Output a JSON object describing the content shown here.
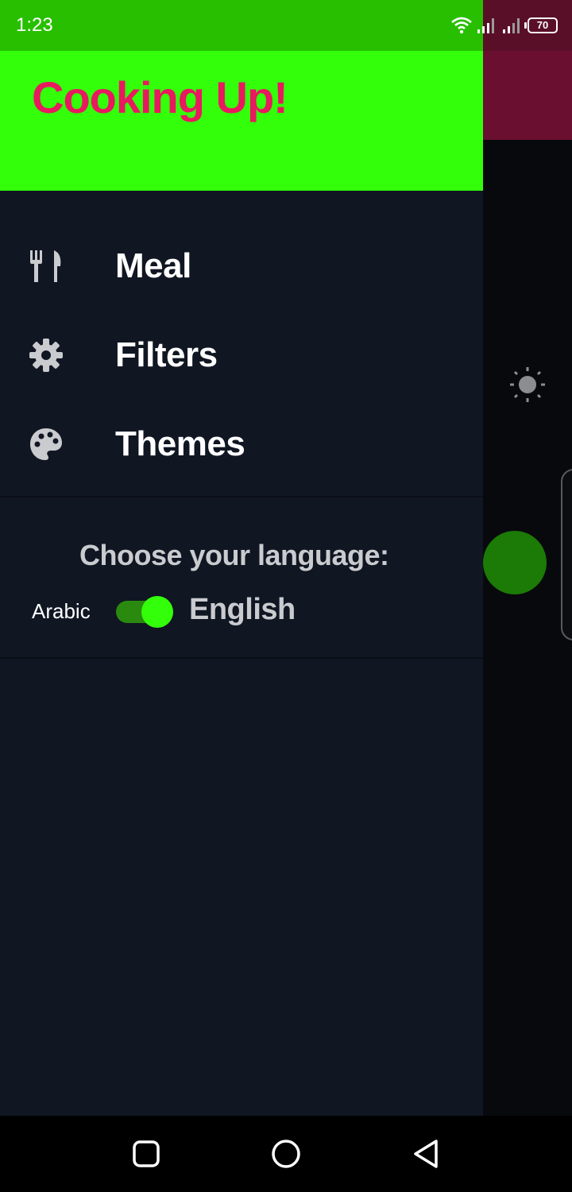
{
  "status_bar": {
    "time": "1:23",
    "battery": "70",
    "left_color": "#28bf00",
    "right_color": "#5a0f28",
    "icons": [
      "wifi-icon",
      "signal-icon",
      "signal-icon",
      "battery-icon"
    ]
  },
  "drawer": {
    "title": "Cooking Up!",
    "header_color": "#33ff0a",
    "title_color": "#e8195f",
    "menu": [
      {
        "label": "Meal",
        "icon": "fork-knife-icon"
      },
      {
        "label": "Filters",
        "icon": "gear-icon"
      },
      {
        "label": "Themes",
        "icon": "palette-icon"
      }
    ],
    "language": {
      "title": "Choose your language:",
      "option_left": "Arabic",
      "option_right": "English",
      "switch_on": true
    }
  },
  "background_app": {
    "icons": [
      "sun-icon",
      "moon-icon"
    ],
    "accent_color": "#6b0f30"
  },
  "nav_bar": {
    "icons": [
      "recent-apps-icon",
      "home-icon",
      "back-icon"
    ]
  }
}
